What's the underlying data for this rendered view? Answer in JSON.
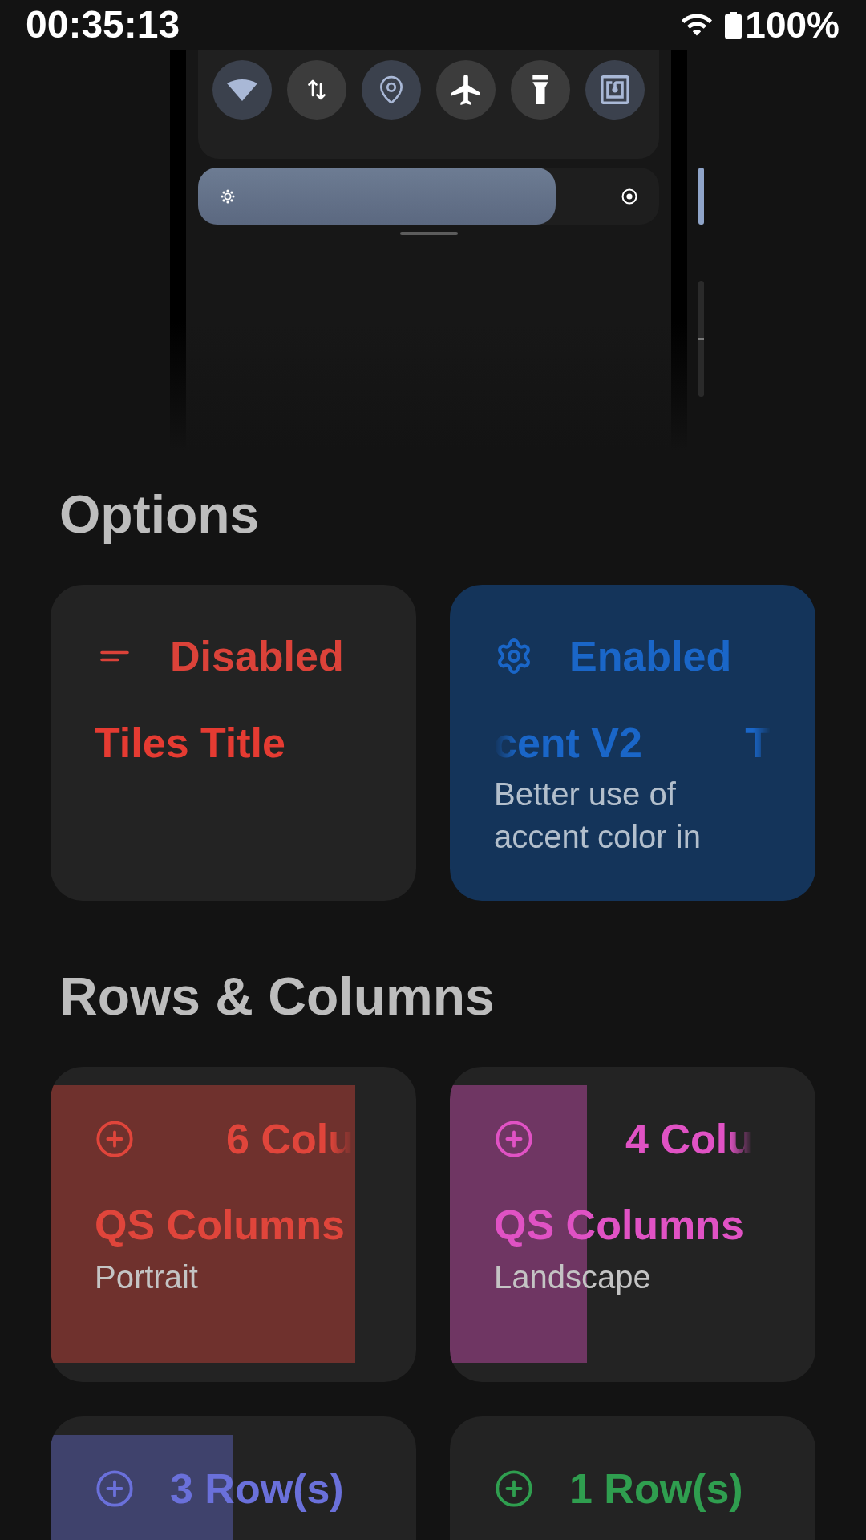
{
  "status_bar": {
    "time": "00:35:13",
    "battery": "100%"
  },
  "preview": {
    "qs_tiles": [
      {
        "kind": "wifi",
        "on": true
      },
      {
        "kind": "data",
        "on": false
      },
      {
        "kind": "location",
        "on": true
      },
      {
        "kind": "airplane",
        "on": false
      },
      {
        "kind": "flashlight",
        "on": false
      },
      {
        "kind": "nfc",
        "on": true
      }
    ],
    "brightness": {
      "level": 0.775
    }
  },
  "options": {
    "title": "Options",
    "cards": [
      {
        "enabled": false,
        "state": "Disabled",
        "scrolling": false,
        "title_fragments": [
          "Tiles Title"
        ]
      },
      {
        "enabled": true,
        "state": "Enabled",
        "scrolling": true,
        "title_fragments": [
          "cent V2",
          "T"
        ],
        "description": "Better use of accent color in"
      }
    ]
  },
  "rows_columns": {
    "title": "Rows & Columns",
    "cards": [
      {
        "value": "6 Colu",
        "scrolling": true,
        "title": "QS Columns",
        "subtitle": "Portrait",
        "color": "#e0453b",
        "level": 0.833
      },
      {
        "value": "4 Colu",
        "scrolling": true,
        "title": "QS Columns",
        "subtitle": "Landscape",
        "color": "#e052c4",
        "level": 0.375
      },
      {
        "value": "3 Row(s)",
        "scrolling": false,
        "color": "#6a70da",
        "level": 0.5
      },
      {
        "value": "1 Row(s)",
        "scrolling": false,
        "color": "#2f9e4f",
        "level": 0
      }
    ]
  }
}
